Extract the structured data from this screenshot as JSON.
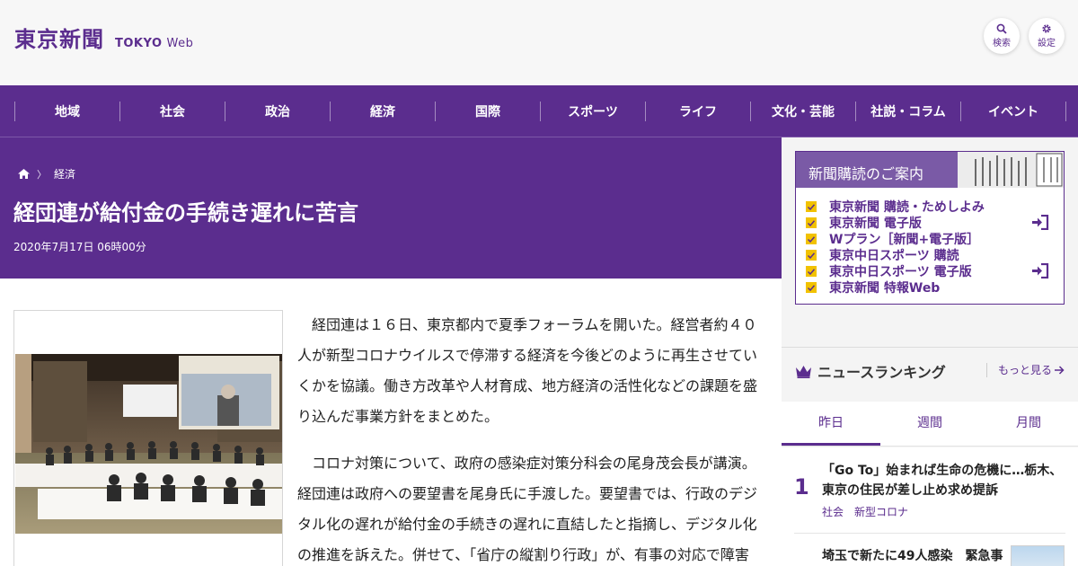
{
  "header": {
    "logo_ja": "東京新聞",
    "logo_en_bold": "TOKYO",
    "logo_en_light": "Web",
    "search_label": "検索",
    "settings_label": "設定"
  },
  "nav": {
    "items": [
      "地域",
      "社会",
      "政治",
      "経済",
      "国際",
      "スポーツ",
      "ライフ",
      "文化・芸能",
      "社説・コラム",
      "イベント"
    ]
  },
  "breadcrumb": {
    "category": "経済"
  },
  "article": {
    "title": "経団連が給付金の手続き遅れに苦言",
    "date": "2020年7月17日 06時00分",
    "paragraphs": [
      "経団連は１６日、東京都内で夏季フォーラムを開いた。経営者約４０人が新型コロナウイルスで停滞する経済を今後どのように再生させていくかを協議。働き方改革や人材育成、地方経済の活性化などの課題を盛り込んだ事業方針をまとめた。",
      "コロナ対策について、政府の感染症対策分科会の尾身茂会長が講演。経団連は政府への要望書を尾身氏に手渡した。要望書では、行政のデジタル化の遅れが給付金の手続きの遅れに直結したと指摘し、デジタル化の推進を訴えた。併せて、「省庁の縦割り行政」が、有事の対応で障害"
    ]
  },
  "subscription": {
    "title": "新聞購読のご案内",
    "items": [
      "東京新聞 購読・ためしよみ",
      "東京新聞 電子版",
      "Wプラン［新聞+電子版］",
      "東京中日スポーツ 購読",
      "東京中日スポーツ 電子版",
      "東京新聞 特報Web"
    ]
  },
  "ranking": {
    "title": "ニュースランキング",
    "more": "もっと見る",
    "tabs": [
      "昨日",
      "週間",
      "月間"
    ],
    "items": [
      {
        "rank": "1",
        "line1": "「Go To」始まれば生命の危機に…栃木、",
        "line2": "東京の住民が差し止め求め提訴",
        "tags": [
          "社会",
          "新型コロナ"
        ]
      },
      {
        "rank": "",
        "line1": "埼玉で新たに49人感染　緊急事",
        "line2": "",
        "tags": []
      }
    ]
  },
  "colors": {
    "brand_purple": "#5b2d8e",
    "check_yellow": "#f2c200"
  }
}
